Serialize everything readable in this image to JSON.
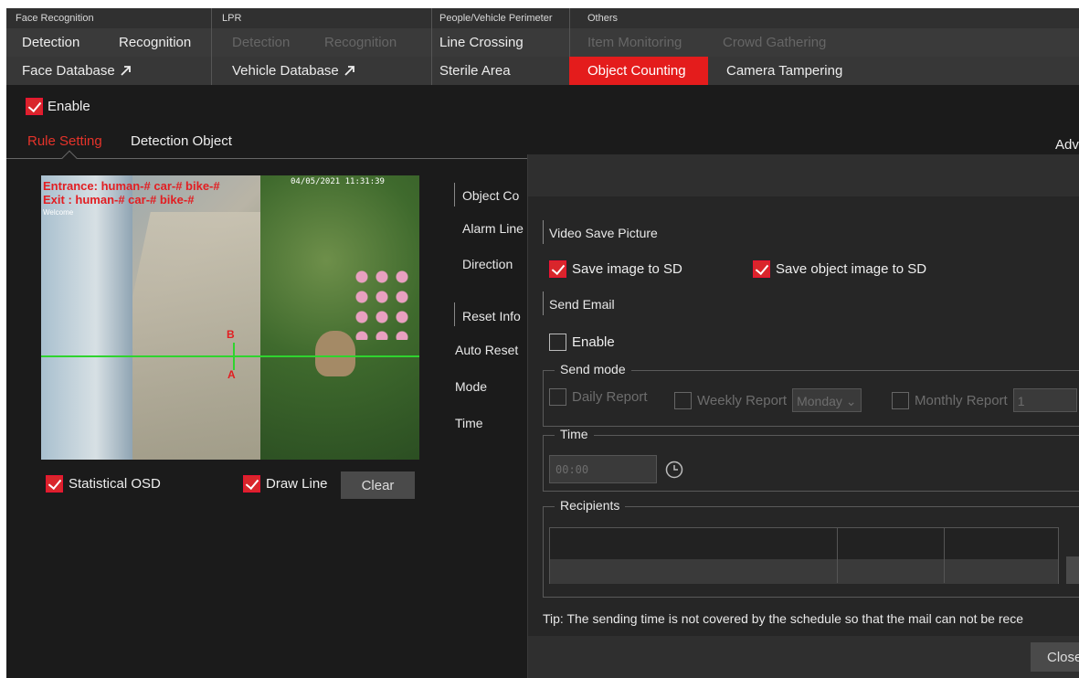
{
  "menu": {
    "groups": [
      {
        "label": "Face Recognition",
        "row1": [
          "Detection",
          "Recognition"
        ],
        "row2": [
          "Face Database"
        ]
      },
      {
        "label": "LPR",
        "row1": [
          "Detection",
          "Recognition"
        ],
        "row2": [
          "Vehicle Database"
        ]
      },
      {
        "label": "People/Vehicle Perimeter",
        "row1": [
          "Line Crossing"
        ],
        "row2": [
          "Sterile Area"
        ]
      },
      {
        "label": "Others",
        "row1": [
          "Item Monitoring",
          "Crowd Gathering"
        ],
        "row2": [
          "Object Counting",
          "Camera Tampering"
        ]
      }
    ],
    "active_item": "Object Counting",
    "accent_color": "#e41c1c"
  },
  "enable": {
    "label": "Enable",
    "checked": true
  },
  "tabs": {
    "rule_setting": "Rule Setting",
    "detection_object": "Detection Object",
    "advanced": "Adv"
  },
  "video": {
    "osd_entrance": "Entrance: human-# car-# bike-#",
    "osd_exit": "Exit    : human-# car-# bike-#",
    "osd_welcome": "Welcome",
    "timestamp": "04/05/2021 11:31:39",
    "line_a": "A",
    "line_b": "B"
  },
  "controls": {
    "statistical_osd": {
      "label": "Statistical OSD",
      "checked": true
    },
    "draw_line": {
      "label": "Draw Line",
      "checked": true
    },
    "clear": "Clear"
  },
  "rule_panel": {
    "object_counting": "Object Co",
    "alarm_line": "Alarm Line",
    "direction": "Direction",
    "reset_info": "Reset Info",
    "auto_reset": "Auto Reset",
    "mode": "Mode",
    "time": "Time"
  },
  "dialog": {
    "video_save_picture": "Video Save Picture",
    "save_image_sd": {
      "label": "Save image to SD",
      "checked": true
    },
    "save_object_image_sd": {
      "label": "Save object image to SD",
      "checked": true
    },
    "send_email": "Send Email",
    "email_enable": {
      "label": "Enable",
      "checked": false
    },
    "send_mode": {
      "legend": "Send mode",
      "daily": "Daily Report",
      "weekly": "Weekly Report",
      "weekly_value": "Monday",
      "monthly": "Monthly Report",
      "monthly_value": "1"
    },
    "time": {
      "legend": "Time",
      "value": "00:00"
    },
    "recipients": {
      "legend": "Recipients"
    },
    "tip": "Tip: The sending time is not covered by the schedule so that the mail can not be rece",
    "close": "Close"
  }
}
